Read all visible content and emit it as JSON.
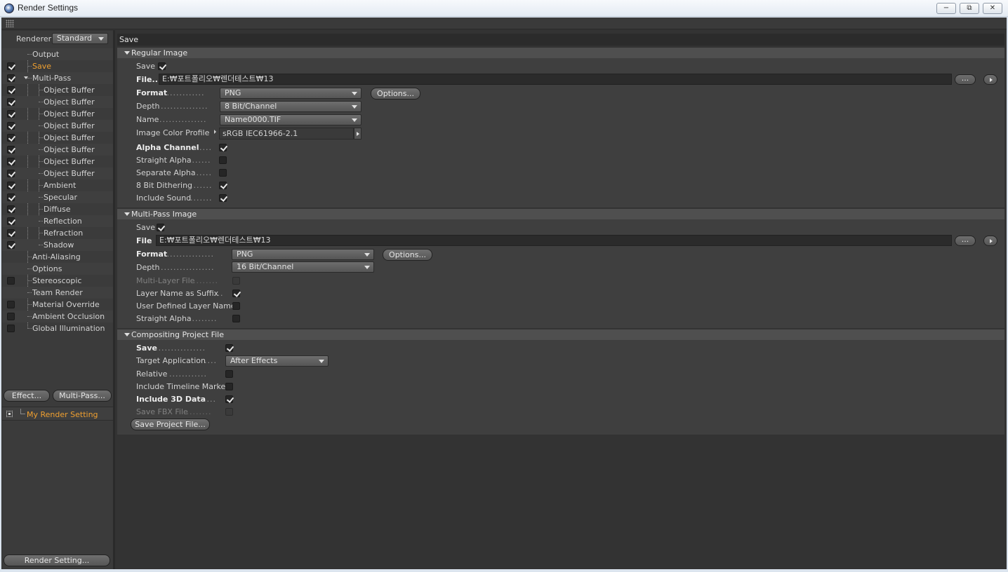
{
  "window": {
    "title": "Render Settings",
    "minimize": "−",
    "restore": "⧉",
    "close": "✕"
  },
  "left": {
    "renderer_label": "Renderer",
    "renderer_value": "Standard",
    "tree": [
      {
        "label": "Output",
        "level": 1,
        "check": "none"
      },
      {
        "label": "Save",
        "level": 1,
        "check": "on",
        "active": true
      },
      {
        "label": "Multi-Pass",
        "level": 1,
        "check": "on",
        "expander": true
      },
      {
        "label": "Object Buffer",
        "level": 2,
        "check": "on"
      },
      {
        "label": "Object Buffer",
        "level": 2,
        "check": "on"
      },
      {
        "label": "Object Buffer",
        "level": 2,
        "check": "on"
      },
      {
        "label": "Object Buffer",
        "level": 2,
        "check": "on"
      },
      {
        "label": "Object Buffer",
        "level": 2,
        "check": "on"
      },
      {
        "label": "Object Buffer",
        "level": 2,
        "check": "on"
      },
      {
        "label": "Object Buffer",
        "level": 2,
        "check": "on"
      },
      {
        "label": "Object Buffer",
        "level": 2,
        "check": "on"
      },
      {
        "label": "Ambient",
        "level": 2,
        "check": "on"
      },
      {
        "label": "Specular",
        "level": 2,
        "check": "on"
      },
      {
        "label": "Diffuse",
        "level": 2,
        "check": "on"
      },
      {
        "label": "Reflection",
        "level": 2,
        "check": "on"
      },
      {
        "label": "Refraction",
        "level": 2,
        "check": "on"
      },
      {
        "label": "Shadow",
        "level": 2,
        "check": "on"
      },
      {
        "label": "Anti-Aliasing",
        "level": 1,
        "check": "none"
      },
      {
        "label": "Options",
        "level": 1,
        "check": "none"
      },
      {
        "label": "Stereoscopic",
        "level": 1,
        "check": "off"
      },
      {
        "label": "Team Render",
        "level": 1,
        "check": "none"
      },
      {
        "label": "Material Override",
        "level": 1,
        "check": "off"
      },
      {
        "label": "Ambient Occlusion",
        "level": 1,
        "check": "off"
      },
      {
        "label": "Global Illumination",
        "level": 1,
        "check": "off"
      }
    ],
    "effect_button": "Effect...",
    "multipass_button": "Multi-Pass...",
    "setting_name": "My Render Setting",
    "render_setting_button": "Render Setting..."
  },
  "right": {
    "header": "Save",
    "regular": {
      "title": "Regular Image",
      "save_label": "Save",
      "file_label": "File...",
      "file_path": "E:₩포트폴리오₩렌더테스트₩13",
      "browse": "...",
      "format_label": "Format",
      "format_value": "PNG",
      "options_button": "Options...",
      "depth_label": "Depth",
      "depth_value": "8 Bit/Channel",
      "name_label": "Name",
      "name_value": "Name0000.TIF",
      "profile_label": "Image Color Profile",
      "profile_value": "sRGB IEC61966-2.1",
      "alpha_label": "Alpha Channel",
      "straight_label": "Straight Alpha",
      "separate_label": "Separate Alpha",
      "dither_label": "8 Bit Dithering",
      "sound_label": "Include Sound"
    },
    "multipass": {
      "title": "Multi-Pass Image",
      "save_label": "Save",
      "file_label": "File",
      "file_path": "E:₩포트폴리오₩렌더테스트₩13",
      "browse": "...",
      "format_label": "Format",
      "format_value": "PNG",
      "options_button": "Options...",
      "depth_label": "Depth",
      "depth_value": "16 Bit/Channel",
      "multilayer_label": "Multi-Layer File",
      "suffix_label": "Layer Name as Suffix",
      "userdef_label": "User Defined Layer Name",
      "straight_label": "Straight Alpha"
    },
    "compositing": {
      "title": "Compositing Project File",
      "save_label": "Save",
      "target_label": "Target Application",
      "target_value": "After Effects",
      "relative_label": "Relative",
      "timeline_label": "Include Timeline Marker",
      "data3d_label": "Include 3D Data",
      "fbx_label": "Save FBX File",
      "save_project_button": "Save Project File..."
    }
  }
}
